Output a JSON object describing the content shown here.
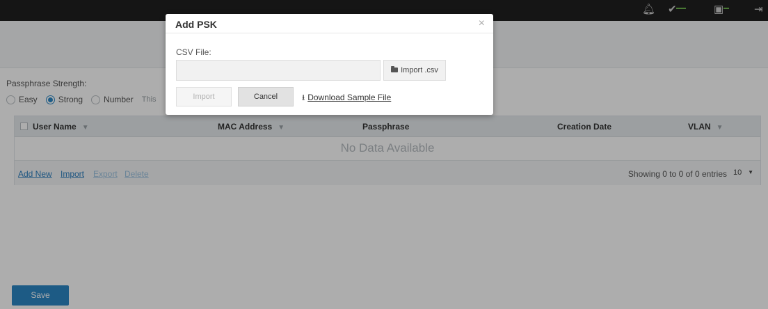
{
  "topbar": {
    "icons": [
      "bell-icon",
      "check-circle-icon",
      "image-icon",
      "logout-icon"
    ]
  },
  "form": {
    "strength_label": "Passphrase Strength:",
    "strength_options": [
      "Easy",
      "Strong",
      "Number"
    ],
    "selected": "Strong",
    "hint": "This"
  },
  "table": {
    "columns": [
      "User Name",
      "MAC Address",
      "Passphrase",
      "Creation Date",
      "VLAN"
    ],
    "empty_text": "No Data Available",
    "actions": [
      "Add New",
      "Import",
      "Export",
      "Delete"
    ],
    "showing": "Showing 0 to 0 of 0 entries",
    "page_size": "10"
  },
  "save_label": "Save",
  "modal": {
    "title": "Add PSK",
    "close": "×",
    "csv_label": "CSV File:",
    "csv_value": "",
    "import_csv": "Import .csv",
    "import_btn": "Import",
    "cancel_btn": "Cancel",
    "download_link": "Download Sample File"
  },
  "colors": {
    "accent": "#2b86c5",
    "topbar": "#1f1f1f",
    "status_green": "#6ab04c"
  }
}
